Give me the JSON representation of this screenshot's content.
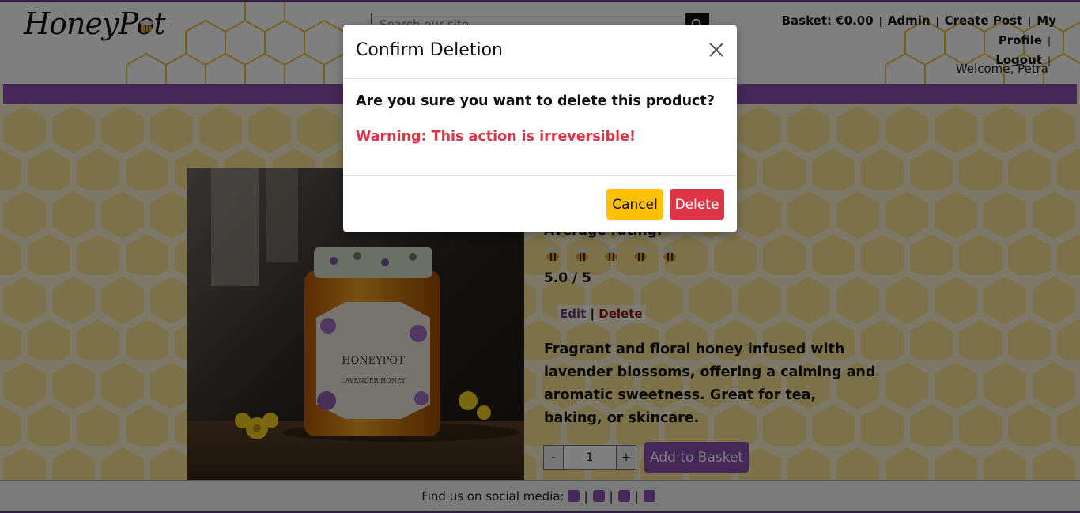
{
  "header": {
    "logo_text": "HoneyPot",
    "search_placeholder": "Search our site...",
    "nav": {
      "basket": "Basket: €0.00",
      "admin": "Admin",
      "create_post": "Create Post",
      "my_profile": "My Profile",
      "logout": "Logout"
    },
    "welcome": "Welcome, Petra"
  },
  "product": {
    "image_label": "HONEYPOT",
    "image_sublabel": "LAVENDER HONEY",
    "rating_label": "Average rating:",
    "rating_bees": 5,
    "rating_value": "5.0 / 5",
    "edit_label": "Edit",
    "edit_sep": "|",
    "delete_label": "Delete",
    "description": "Fragrant and floral honey infused with lavender blossoms, offering a calming and aromatic sweetness. Great for tea, baking, or skincare.",
    "qty_minus": "-",
    "qty_value": "1",
    "qty_plus": "+",
    "add_to_basket": "Add to Basket"
  },
  "footer": {
    "text": "Find us on social media:",
    "icons": [
      "github-icon",
      "facebook-icon",
      "youtube-icon",
      "instagram-icon"
    ]
  },
  "modal": {
    "title": "Confirm Deletion",
    "question": "Are you sure you want to delete this product?",
    "warning": "Warning: This action is irreversible!",
    "cancel": "Cancel",
    "delete": "Delete"
  },
  "colors": {
    "brand_purple": "#8a4fb0",
    "honey_yellow": "#f2c94c",
    "cancel_yellow": "#ffc107",
    "danger_red": "#dc3545"
  }
}
